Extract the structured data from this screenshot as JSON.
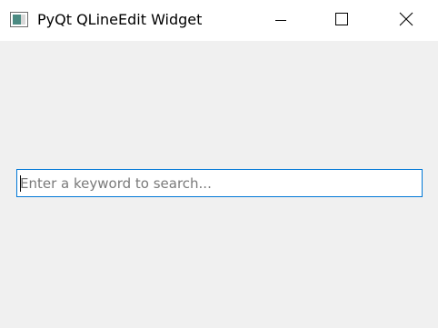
{
  "window": {
    "title": "PyQt QLineEdit Widget"
  },
  "icons": {
    "app": "app-window-icon",
    "minimize": "minimize-icon",
    "maximize": "maximize-icon",
    "close": "close-icon"
  },
  "search": {
    "value": "",
    "placeholder": "Enter a keyword to search..."
  },
  "colors": {
    "focus_border": "#0078d7",
    "background": "#f0f0f0",
    "titlebar": "#ffffff",
    "placeholder": "#7a7a7a"
  }
}
